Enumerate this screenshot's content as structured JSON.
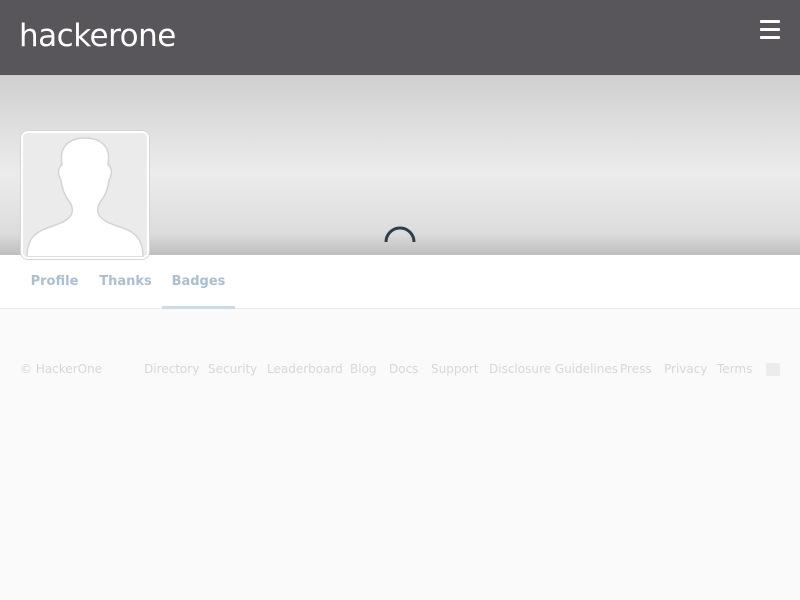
{
  "header": {
    "logo_text": "hackerone",
    "menu_icon": "hamburger-menu-icon",
    "background_color": "#58565a"
  },
  "profile": {
    "avatar_icon": "default-user-silhouette-icon",
    "loading_icon": "loading-spinner-icon"
  },
  "tabs": [
    {
      "label": "Profile"
    },
    {
      "label": "Thanks"
    },
    {
      "label": "Badges",
      "active": true
    }
  ],
  "footer": {
    "copyright": "© HackerOne",
    "links": [
      "Directory",
      "Security",
      "Leaderboard",
      "Blog",
      "Docs",
      "Support",
      "Disclosure Guidelines",
      "Press",
      "Privacy",
      "Terms"
    ],
    "social_icon": "twitter-icon"
  },
  "colors": {
    "tab_text": "#a9bfd2",
    "footer_text": "#d7d7d7",
    "spinner": "#2d3e4d"
  }
}
